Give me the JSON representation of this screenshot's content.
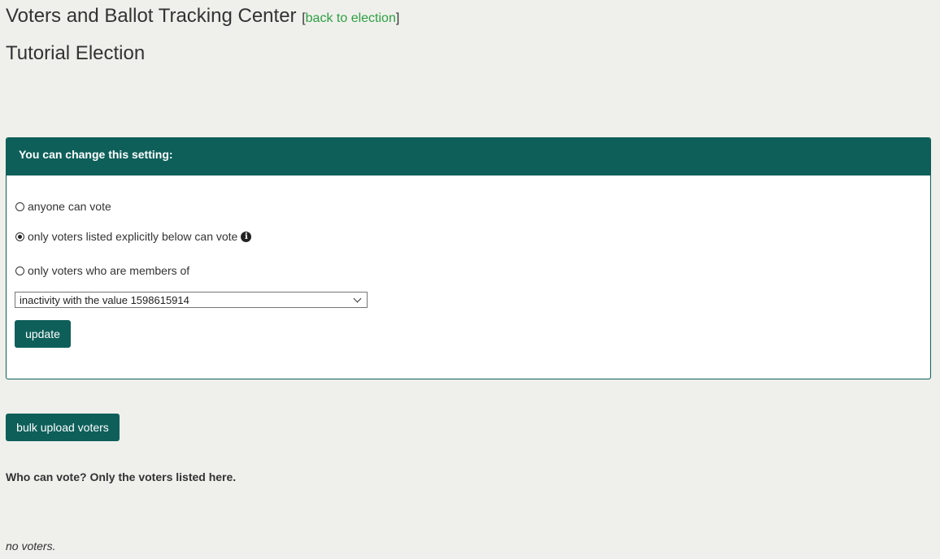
{
  "header": {
    "title": "Voters and Ballot Tracking Center",
    "back_link_open": "[",
    "back_link_label": "back to election",
    "back_link_close": "]"
  },
  "election": {
    "name": "Tutorial Election"
  },
  "settings_panel": {
    "heading": "You can change this setting:",
    "options": [
      {
        "label": "anyone can vote",
        "checked": false
      },
      {
        "label": "only voters listed explicitly below can vote",
        "checked": true
      },
      {
        "label": "only voters who are members of",
        "checked": false
      }
    ],
    "category_select_value": "inactivity with the value 1598615914",
    "update_label": "update"
  },
  "bulk_upload_label": "bulk upload voters",
  "voters_heading": "Who can vote? Only the voters listed here.",
  "voters_empty": "no voters.",
  "colors": {
    "accent": "#0e5f5a",
    "link": "#2e9f43",
    "background": "#eff0eb"
  },
  "icons": {
    "info": "info-circle-icon"
  }
}
